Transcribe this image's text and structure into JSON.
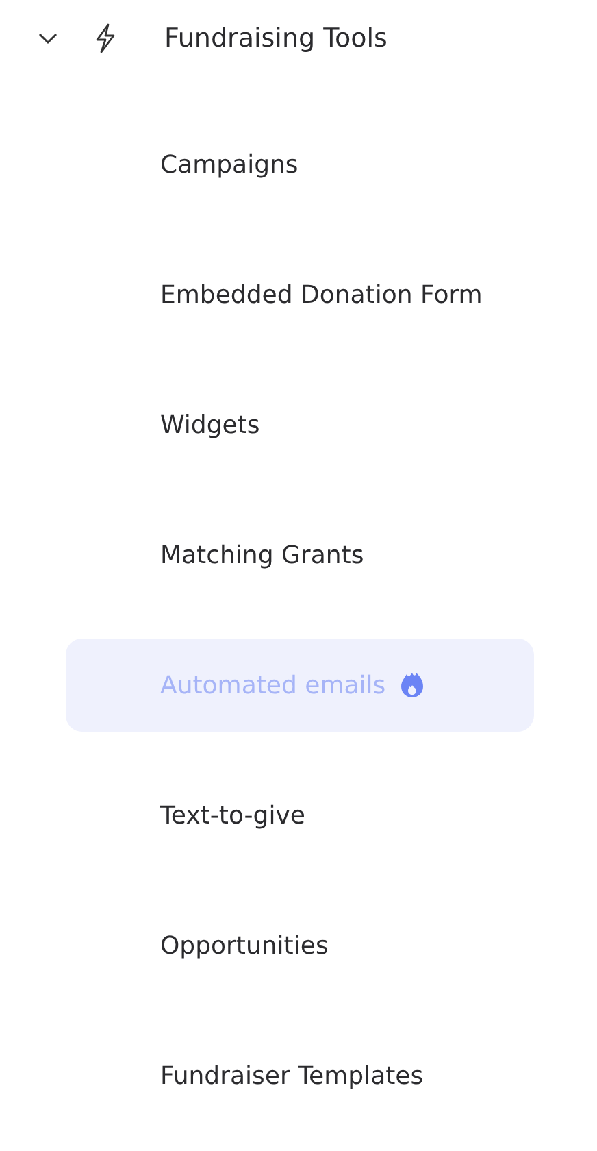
{
  "group": {
    "label": "Fundraising Tools",
    "expanded": true
  },
  "items": [
    {
      "label": "Campaigns",
      "selected": false,
      "hot": false
    },
    {
      "label": "Embedded Donation Form",
      "selected": false,
      "hot": false
    },
    {
      "label": "Widgets",
      "selected": false,
      "hot": false
    },
    {
      "label": "Matching Grants",
      "selected": false,
      "hot": false
    },
    {
      "label": "Automated emails",
      "selected": true,
      "hot": true
    },
    {
      "label": "Text-to-give",
      "selected": false,
      "hot": false
    },
    {
      "label": "Opportunities",
      "selected": false,
      "hot": false
    },
    {
      "label": "Fundraiser Templates",
      "selected": false,
      "hot": false
    }
  ]
}
